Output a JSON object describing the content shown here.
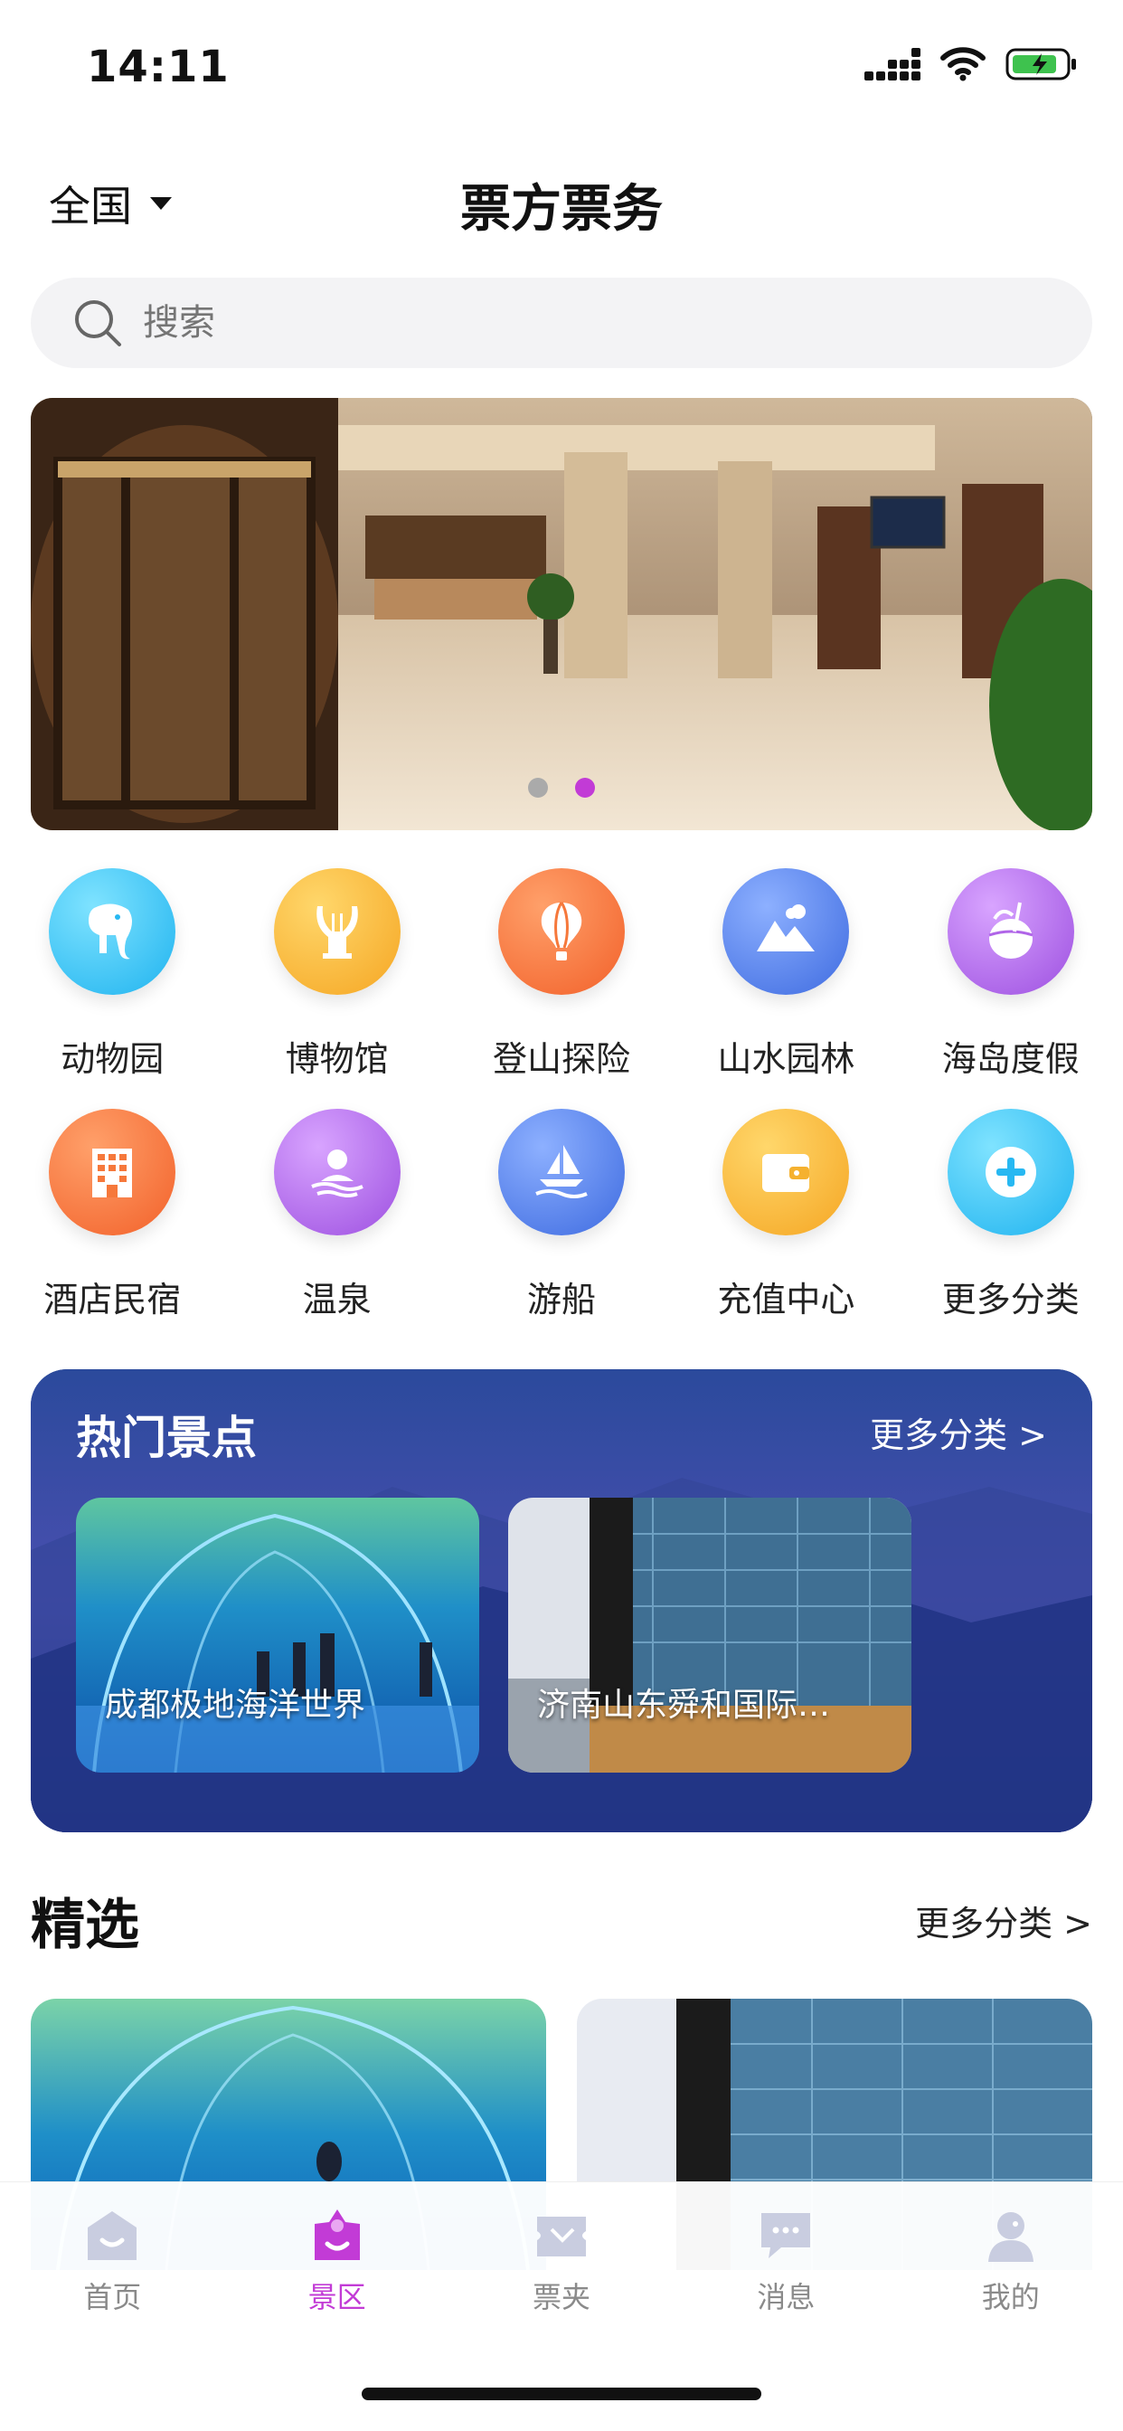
{
  "status_bar": {
    "time": "14:11"
  },
  "header": {
    "region": "全国",
    "title": "票方票务"
  },
  "search": {
    "placeholder": "搜索"
  },
  "banner": {
    "page_count": 2,
    "active_page": 2
  },
  "categories": [
    {
      "label": "动物园",
      "icon": "elephant-icon",
      "color": "#27b8f2"
    },
    {
      "label": "博物馆",
      "icon": "museum-lyre-icon",
      "color": "#f5b12f"
    },
    {
      "label": "登山探险",
      "icon": "hot-air-balloon-icon",
      "color": "#f6783b"
    },
    {
      "label": "山水园林",
      "icon": "mountain-icon",
      "color": "#4f7de8"
    },
    {
      "label": "海岛度假",
      "icon": "coconut-drink-icon",
      "color": "#b065e8"
    },
    {
      "label": "酒店民宿",
      "icon": "hotel-building-icon",
      "color": "#f6783b"
    },
    {
      "label": "温泉",
      "icon": "hot-spring-icon",
      "color": "#b065e8"
    },
    {
      "label": "游船",
      "icon": "sailboat-icon",
      "color": "#4f7de8"
    },
    {
      "label": "充值中心",
      "icon": "wallet-icon",
      "color": "#f5b12f"
    },
    {
      "label": "更多分类",
      "icon": "plus-circle-icon",
      "color": "#27b8f2"
    }
  ],
  "hot": {
    "title": "热门景点",
    "more": "更多分类 >",
    "cards": [
      {
        "label": "成都极地海洋世界"
      },
      {
        "label": "济南山东舜和国际…"
      }
    ]
  },
  "featured": {
    "title": "精选",
    "more": "更多分类 >"
  },
  "tabbar": {
    "tabs": [
      {
        "label": "首页",
        "icon": "home-icon"
      },
      {
        "label": "景区",
        "icon": "scenic-area-icon",
        "active": true
      },
      {
        "label": "票夹",
        "icon": "ticket-icon"
      },
      {
        "label": "消息",
        "icon": "message-icon"
      },
      {
        "label": "我的",
        "icon": "profile-icon"
      }
    ],
    "active_color": "#c23bd6"
  }
}
